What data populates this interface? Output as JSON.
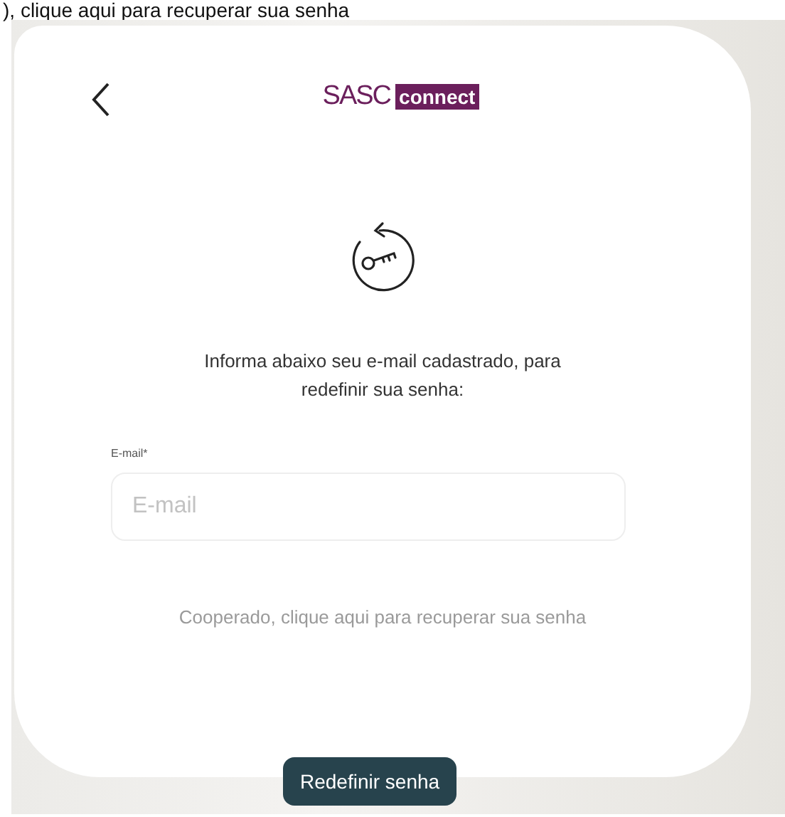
{
  "top_text": "), clique aqui para recuperar sua senha",
  "header": {
    "logo": {
      "brand": "SASC",
      "product": "connect"
    }
  },
  "instructions": "Informa abaixo seu e-mail cadastrado, para redefinir sua senha:",
  "email_field": {
    "label": "E-mail*",
    "placeholder": "E-mail"
  },
  "cooperado_link": "Cooperado, clique aqui para recuperar sua senha",
  "submit_button": "Redefinir senha"
}
